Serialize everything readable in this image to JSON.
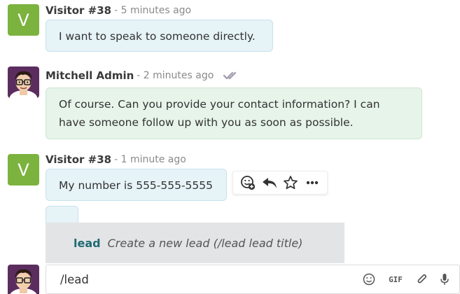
{
  "messages": [
    {
      "author": "Visitor #38",
      "avatar_letter": "V",
      "time": "- 5 minutes ago",
      "text": "I want to speak to someone directly."
    },
    {
      "author": "Mitchell Admin",
      "time": "- 2 minutes ago",
      "text_line1": "Of course. Can you provide your contact information? I can",
      "text_line2": "have someone follow up with you as soon as possible."
    },
    {
      "author": "Visitor #38",
      "avatar_letter": "V",
      "time": "- 1 minute ago",
      "text": "My number is 555-555-5555"
    }
  ],
  "suggestion": {
    "command": "lead",
    "description": "Create a new lead (/lead lead title)"
  },
  "composer": {
    "value": "/lead",
    "gif_label": "GIF"
  },
  "colors": {
    "visitor_avatar": "#7cb33f",
    "visitor_bubble": "#e6f3f7",
    "admin_bubble": "#e6f4e9",
    "suggestion_bg": "#e3e4e6",
    "command_text": "#1f6b73"
  }
}
